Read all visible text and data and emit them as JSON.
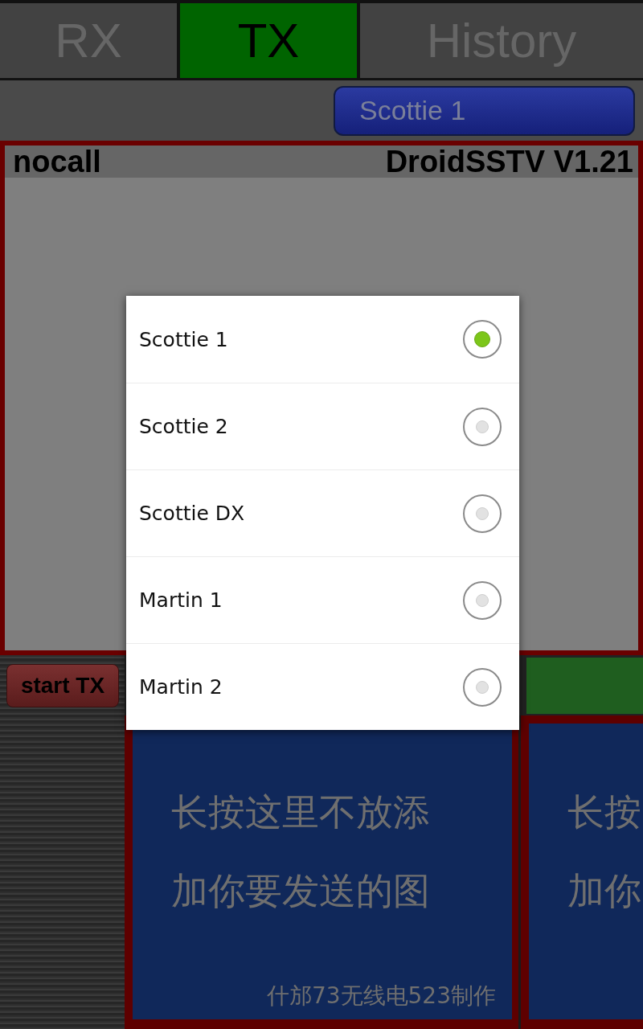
{
  "tabs": [
    {
      "label": "RX",
      "selected": false
    },
    {
      "label": "TX",
      "selected": true
    },
    {
      "label": "History",
      "selected": false
    }
  ],
  "mode_button": "Scottie 1",
  "canvas": {
    "callsign": "nocall",
    "app_version": "DroidSSTV V1.21"
  },
  "start_button": "start TX",
  "image_slots": [
    {
      "lines": [
        "长按这里不放添",
        "加你要发送的图"
      ],
      "credit": "什邡73无线电523制作"
    },
    {
      "lines": [
        "长按",
        "加你"
      ]
    }
  ],
  "mode_dialog": {
    "options": [
      {
        "label": "Scottie 1",
        "selected": true
      },
      {
        "label": "Scottie 2",
        "selected": false
      },
      {
        "label": "Scottie DX",
        "selected": false
      },
      {
        "label": "Martin 1",
        "selected": false
      },
      {
        "label": "Martin 2",
        "selected": false
      }
    ]
  }
}
